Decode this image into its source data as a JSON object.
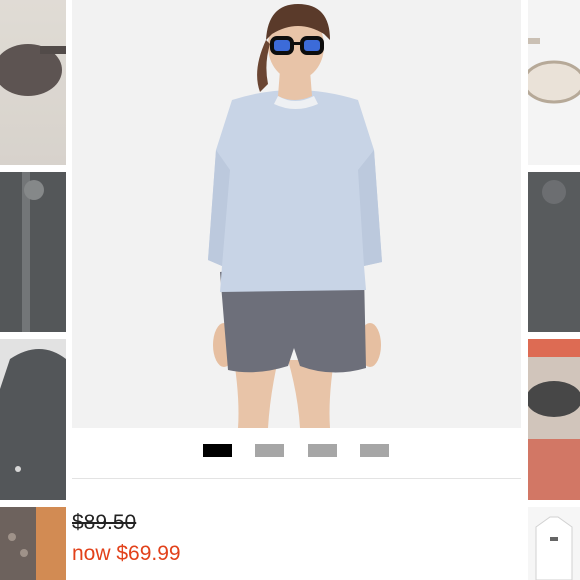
{
  "product": {
    "original_price": "$89.50",
    "sale_price": "now $69.99"
  },
  "carousel": {
    "image_count": 4,
    "active_index": 0
  },
  "colors": {
    "active_dot": "#000000",
    "inactive_dot": "#a6a6a6",
    "sale_price": "#e2411a",
    "divider": "#e3e3e3"
  },
  "side_thumbnails": {
    "left": [
      "sunglasses",
      "black jacket",
      "black hooded jacket",
      "studded bag"
    ],
    "right": [
      "sunglasses",
      "dark jacket",
      "sunglasses on red top",
      "white top"
    ]
  }
}
